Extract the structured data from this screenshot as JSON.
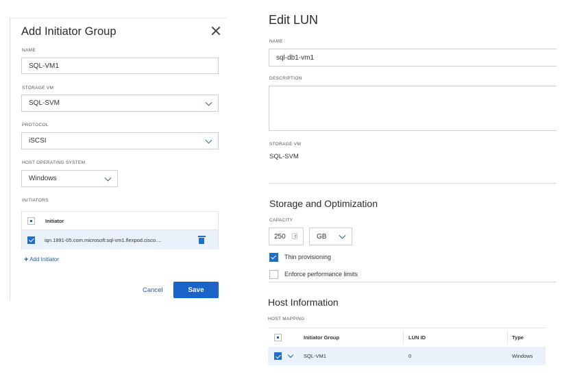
{
  "add_initiator_group": {
    "title": "Add Initiator Group",
    "name_label": "NAME",
    "name_value": "SQL-VM1",
    "storage_vm_label": "STORAGE VM",
    "storage_vm_value": "SQL-SVM",
    "protocol_label": "PROTOCOL",
    "protocol_value": "iSCSI",
    "host_os_label": "HOST OPERATING SYSTEM",
    "host_os_value": "Windows",
    "initiators_label": "INITIATORS",
    "initiators_header": "Initiator",
    "initiators": [
      "iqn.1991-05.com.microsoft:sql-vm1.flexpod.cisco...."
    ],
    "add_initiator_label": "Add Initiator",
    "cancel_label": "Cancel",
    "save_label": "Save"
  },
  "edit_lun": {
    "title": "Edit LUN",
    "name_label": "NAME",
    "name_value": "sql-db1-vm1",
    "description_label": "DESCRIPTION",
    "description_value": "",
    "storage_vm_label": "STORAGE VM",
    "storage_vm_value": "SQL-SVM",
    "storage_section_title": "Storage and Optimization",
    "capacity_label": "CAPACITY",
    "capacity_value": "250",
    "capacity_unit": "GB",
    "thin_provisioning_label": "Thin provisioning",
    "thin_provisioning_checked": true,
    "enforce_limits_label": "Enforce performance limits",
    "enforce_limits_checked": false,
    "host_section_title": "Host Information",
    "host_mapping_label": "HOST MAPPING",
    "table_headers": [
      "Initiator Group",
      "LUN ID",
      "Type"
    ],
    "rows": [
      {
        "initiator_group": "SQL-VM1",
        "lun_id": "0",
        "type": "Windows"
      }
    ]
  },
  "colors": {
    "accent": "#1a63c8",
    "row_selected": "#eaf1fb",
    "border": "#cfcfcf"
  }
}
